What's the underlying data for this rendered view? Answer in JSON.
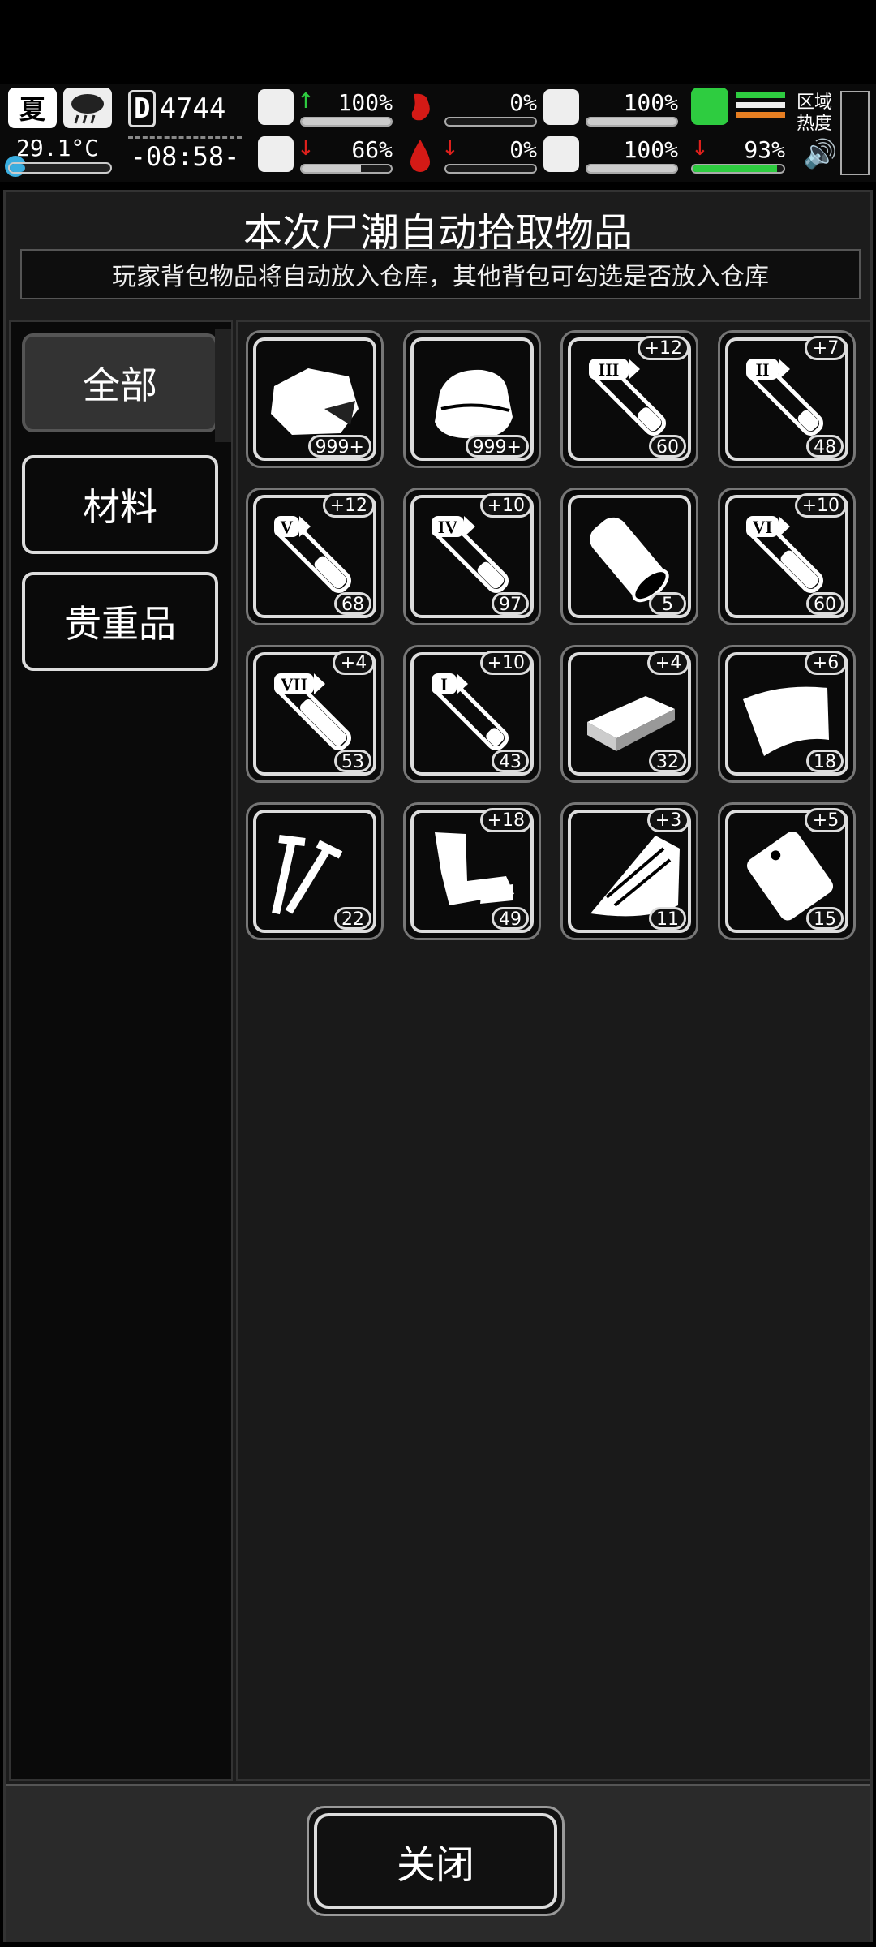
{
  "status": {
    "season": "夏",
    "temperature": "29.1°C",
    "temperature_level": 0.15,
    "day_prefix": "D",
    "day": "4744",
    "time": "-08:58-",
    "stats": [
      {
        "id": "health",
        "icon": "medkit-icon",
        "arrow": "↑",
        "arrow_color": "#2ecc40",
        "value": "100%",
        "level": 1.0
      },
      {
        "id": "hunger",
        "icon": "stomach-icon",
        "arrow": "",
        "arrow_color": "",
        "value": "0%",
        "level": 0.0
      },
      {
        "id": "armor",
        "icon": "helmet-icon",
        "arrow": "",
        "arrow_color": "",
        "value": "100%",
        "level": 1.0
      },
      {
        "id": "mind",
        "icon": "brain-icon",
        "arrow": "↓",
        "arrow_color": "#e0201c",
        "value": "66%",
        "level": 0.66
      },
      {
        "id": "bleed",
        "icon": "blood-drop-icon",
        "arrow": "↓",
        "arrow_color": "#e0201c",
        "value": "0%",
        "level": 0.0
      },
      {
        "id": "mood",
        "icon": "heart-icon",
        "arrow": "",
        "arrow_color": "",
        "value": "100%",
        "level": 1.0
      },
      {
        "id": "stamina",
        "icon": "boot-icon",
        "arrow": "↓",
        "arrow_color": "#e0201c",
        "value": "93%",
        "level": 0.93
      }
    ],
    "region_label": "区域热度"
  },
  "panel": {
    "title": "本次尸潮自动拾取物品",
    "subtitle": "玩家背包物品将自动放入仓库，其他背包可勾选是否放入仓库"
  },
  "categories": [
    {
      "label": "全部",
      "active": true
    },
    {
      "label": "材料",
      "active": false
    },
    {
      "label": "贵重品",
      "active": false
    }
  ],
  "items": [
    {
      "icon": "cloth-scrap-icon",
      "count": "999+",
      "bonus": ""
    },
    {
      "icon": "cloth-stack-icon",
      "count": "999+",
      "bonus": ""
    },
    {
      "icon": "test-tube-iii-icon",
      "count": "60",
      "bonus": "+12",
      "roman": "III",
      "fill": 0.3
    },
    {
      "icon": "test-tube-ii-icon",
      "count": "48",
      "bonus": "+7",
      "roman": "II",
      "fill": 0.25
    },
    {
      "icon": "test-tube-v-icon",
      "count": "68",
      "bonus": "+12",
      "roman": "V",
      "fill": 0.45
    },
    {
      "icon": "test-tube-iv-icon",
      "count": "97",
      "bonus": "+10",
      "roman": "IV",
      "fill": 0.35
    },
    {
      "icon": "wood-log-icon",
      "count": "5",
      "bonus": ""
    },
    {
      "icon": "test-tube-vi-icon",
      "count": "60",
      "bonus": "+10",
      "roman": "VI",
      "fill": 0.55
    },
    {
      "icon": "test-tube-vii-icon",
      "count": "53",
      "bonus": "+4",
      "roman": "VII",
      "fill": 0.7
    },
    {
      "icon": "test-tube-i-icon",
      "count": "43",
      "bonus": "+10",
      "roman": "I",
      "fill": 0.2
    },
    {
      "icon": "wood-plank-icon",
      "count": "32",
      "bonus": "+4"
    },
    {
      "icon": "leather-sheet-icon",
      "count": "18",
      "bonus": "+6"
    },
    {
      "icon": "nails-icon",
      "count": "22",
      "bonus": ""
    },
    {
      "icon": "scrap-parts-icon",
      "count": "49",
      "bonus": "+18"
    },
    {
      "icon": "broken-board-icon",
      "count": "11",
      "bonus": "+3"
    },
    {
      "icon": "plastic-bag-icon",
      "count": "15",
      "bonus": "+5"
    }
  ],
  "close_label": "关闭"
}
